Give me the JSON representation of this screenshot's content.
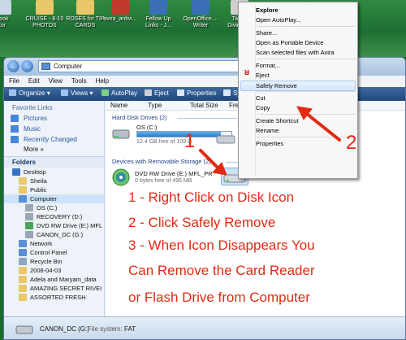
{
  "desktop": {
    "icons": [
      {
        "label": "book\ntor",
        "color": "#c9d7e6"
      },
      {
        "label": "CRUISE - 8-10\nPHOTOS",
        "color": "#e8c86a"
      },
      {
        "label": "ROSES for TIP\nCARDS",
        "color": "#e8c86a"
      },
      {
        "label": "avira_antivi...",
        "color": "#c0392b"
      },
      {
        "label": "Fellow Up\nLinks - J...",
        "color": "#3a6fb8"
      },
      {
        "label": "OpenOffice....\nWriter",
        "color": "#3a6fb8"
      },
      {
        "label": "Talk fr\nDivine Wi",
        "color": "#cfcfcf"
      }
    ]
  },
  "window": {
    "address": "Computer",
    "menu": [
      "File",
      "Edit",
      "View",
      "Tools",
      "Help"
    ],
    "toolbar": {
      "organize": "Organize",
      "views": "Views",
      "autoplay": "AutoPlay",
      "eject": "Eject",
      "properties": "Properties",
      "system": "System"
    },
    "favorites_header": "Favorite Links",
    "favorites": [
      {
        "label": "Pictures",
        "color": "#4a86d6"
      },
      {
        "label": "Music",
        "color": "#4a86d6"
      },
      {
        "label": "Recently Changed",
        "color": "#4a86d6"
      }
    ],
    "more": "More »",
    "folders_header": "Folders",
    "tree": [
      {
        "label": "Desktop",
        "indent": 0,
        "color": "#3b73c4"
      },
      {
        "label": "Sheila",
        "indent": 1,
        "color": "#e8c86a"
      },
      {
        "label": "Public",
        "indent": 1,
        "color": "#e8c86a"
      },
      {
        "label": "Computer",
        "indent": 1,
        "color": "#5b8fd4",
        "selected": true
      },
      {
        "label": "OS (C:)",
        "indent": 2,
        "color": "#9aa7b5"
      },
      {
        "label": "RECOVERY (D:)",
        "indent": 2,
        "color": "#9aa7b5"
      },
      {
        "label": "DVD RW Drive (E:) MFL",
        "indent": 2,
        "color": "#49a35a"
      },
      {
        "label": "CANON_DC (G:)",
        "indent": 2,
        "color": "#9aa7b5"
      },
      {
        "label": "Network",
        "indent": 1,
        "color": "#5b8fd4"
      },
      {
        "label": "Control Panel",
        "indent": 1,
        "color": "#5b8fd4"
      },
      {
        "label": "Recycle Bin",
        "indent": 1,
        "color": "#8fa6bf"
      },
      {
        "label": "2008-04-03",
        "indent": 1,
        "color": "#e8c86a"
      },
      {
        "label": "Adela and Maryam_data",
        "indent": 1,
        "color": "#e8c86a"
      },
      {
        "label": "AMAZING SECRET RIVEI",
        "indent": 1,
        "color": "#e8c86a"
      },
      {
        "label": "ASSORTED FRESH",
        "indent": 1,
        "color": "#e8c86a"
      }
    ],
    "columns": [
      "Name",
      "Type",
      "Total Size",
      "Free"
    ],
    "groups": {
      "hard_disk": "Hard Disk Drives (2)",
      "removable": "Devices with Removable Storage (2)"
    },
    "drives": {
      "os_label": "OS (C:)",
      "os_info": "12.4 GB free of 109 G",
      "os_fill": 0.89,
      "dvd_label": "DVD RW Drive (E:) MFL_PR",
      "dvd_info": "0 bytes free of 495 MB"
    },
    "details": {
      "name": "CANON_DC (G:)",
      "fs_label": "File system:",
      "fs_value": "FAT"
    }
  },
  "context_menu": {
    "items": [
      {
        "label": "Explore",
        "bold": true
      },
      {
        "label": "Open AutoPlay..."
      },
      {
        "sep": true
      },
      {
        "label": "Share..."
      },
      {
        "label": "Open as Portable Device"
      },
      {
        "label": "Scan selected files with Avira"
      },
      {
        "sep": true
      },
      {
        "label": "Format..."
      },
      {
        "label": "Eject"
      },
      {
        "label": "Safely Remove",
        "highlight": true
      },
      {
        "sep": true
      },
      {
        "label": "Cut"
      },
      {
        "label": "Copy"
      },
      {
        "sep": true
      },
      {
        "label": "Create Shortcut"
      },
      {
        "label": "Rename"
      },
      {
        "sep": true
      },
      {
        "label": "Properties"
      }
    ]
  },
  "annotations": {
    "num1": "1",
    "num2": "2",
    "lines": [
      "1 - Right Click on Disk Icon",
      "2 - Click Safely Remove",
      "3 - When Icon Disappears You",
      "Can Remove the Card Reader",
      "or Flash Drive from Computer"
    ],
    "color": "#e02a13"
  }
}
